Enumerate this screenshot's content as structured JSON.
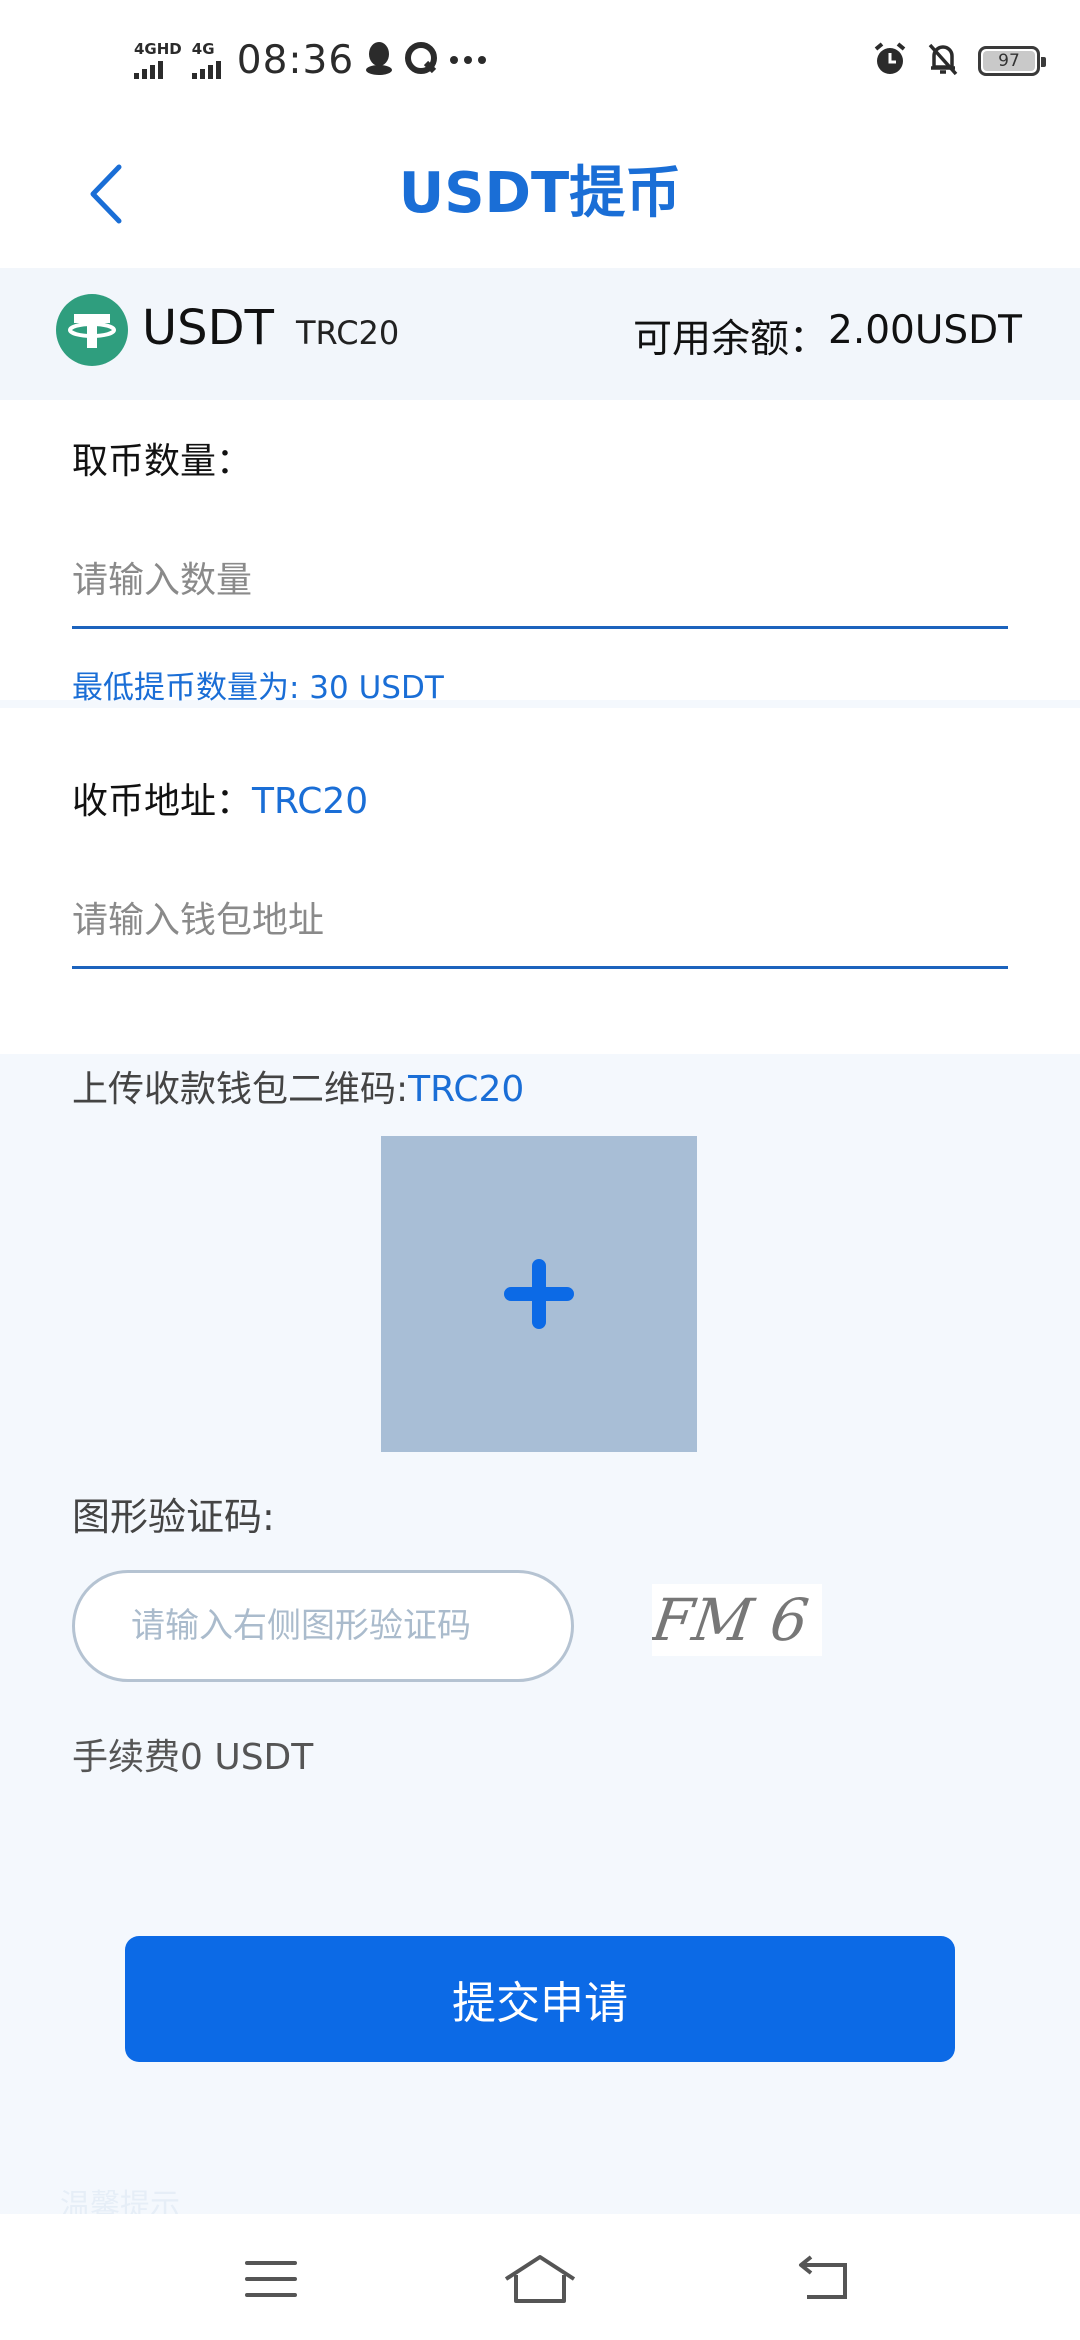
{
  "status_bar": {
    "network_1": "4GHD",
    "network_2": "4G",
    "time": "08:36",
    "battery": "97"
  },
  "header": {
    "title": "USDT提币"
  },
  "coin": {
    "name": "USDT",
    "chain": "TRC20",
    "balance_label": "可用余额：",
    "balance_value": "2.00USDT"
  },
  "amount": {
    "label": "取币数量：",
    "placeholder": "请输入数量",
    "hint": "最低提币数量为: 30 USDT"
  },
  "address": {
    "label": "收币地址：",
    "chain": "TRC20",
    "placeholder": "请输入钱包地址"
  },
  "qrcode": {
    "label": "上传收款钱包二维码:",
    "chain": "TRC20"
  },
  "captcha": {
    "label": "图形验证码:",
    "placeholder": "请输入右侧图形验证码",
    "code": "FM 6"
  },
  "fee": {
    "text": "手续费0 USDT"
  },
  "submit": {
    "label": "提交申请"
  },
  "footer": {
    "note": "温馨提示"
  },
  "colors": {
    "primary": "#0c6ae6",
    "accent_text": "#1a6ed6",
    "tether_green": "#2f9e7e",
    "upload_box": "#a8bed6"
  }
}
